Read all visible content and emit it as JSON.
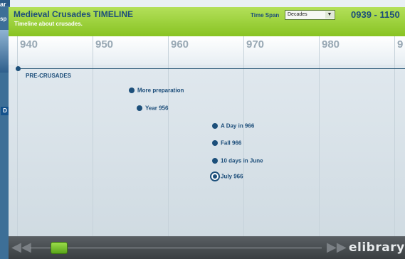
{
  "background_window": {
    "title_fragment": "ar",
    "side_text": "sp",
    "badge": "D"
  },
  "header": {
    "title": "Medieval Crusades TIMELINE",
    "subtitle": "Timeline about crusades.",
    "time_span_label": "Time Span",
    "time_span_value": "Decades",
    "date_range": "0939 - 1150"
  },
  "ruler": {
    "decades": [
      "940",
      "950",
      "960",
      "970",
      "980",
      "9"
    ]
  },
  "timeline": {
    "era_label": "PRE-CRUSADES",
    "events": [
      {
        "label": "More preparation",
        "selected": false
      },
      {
        "label": "Year 956",
        "selected": false
      },
      {
        "label": "A Day in 966",
        "selected": false
      },
      {
        "label": "Fall 966",
        "selected": false
      },
      {
        "label": "10 days in June",
        "selected": false
      },
      {
        "label": "July 966",
        "selected": true
      }
    ]
  },
  "footer": {
    "prev_icon": "◀◀",
    "next_icon": "▶▶",
    "slider_position": 0.07,
    "brand": "elibrary"
  },
  "colors": {
    "header_green": "#99cc33",
    "primary_blue": "#1d4e7a",
    "footer_dark": "#45494c",
    "slider_green": "#6fbf2a"
  }
}
